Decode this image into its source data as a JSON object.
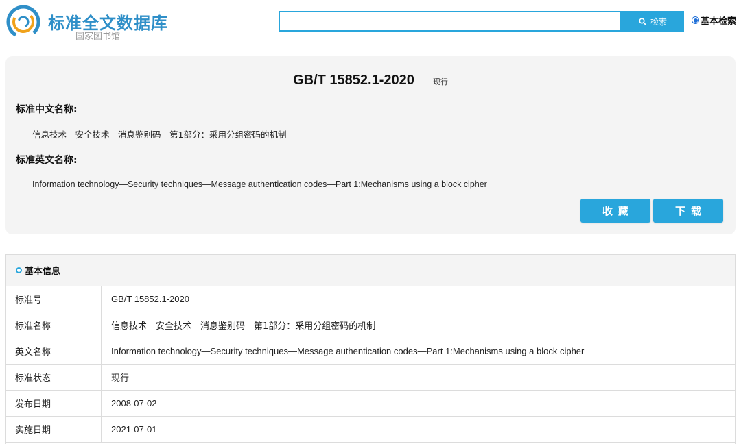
{
  "header": {
    "logo_icon": "circular-swirl-logo-icon",
    "title": "标准全文数据库",
    "subtitle": "国家图书馆",
    "search": {
      "value": "",
      "placeholder": ""
    },
    "search_button_icon": "search-icon",
    "search_button_label": "检索",
    "search_mode_label": "基本检索",
    "search_mode_selected": true
  },
  "summary": {
    "standard_no": "GB/T 15852.1-2020",
    "status": "现行",
    "cn_name_label": "标准中文名称:",
    "cn_name": "信息技术　安全技术　消息鉴别码　第1部分：采用分组密码的机制",
    "en_name_label": "标准英文名称:",
    "en_name": "Information technology—Security techniques—Message authentication codes—Part 1:Mechanisms using a block cipher",
    "collect_label": "收藏",
    "download_label": "下载"
  },
  "basic_info": {
    "title": "基本信息",
    "rows": [
      {
        "key": "标准号",
        "value": "GB/T 15852.1-2020"
      },
      {
        "key": "标准名称",
        "value": "信息技术　安全技术　消息鉴别码　第1部分：采用分组密码的机制"
      },
      {
        "key": "英文名称",
        "value": "Information technology—Security techniques—Message authentication codes—Part 1:Mechanisms using a block cipher"
      },
      {
        "key": "标准状态",
        "value": "现行"
      },
      {
        "key": "发布日期",
        "value": "2008-07-02"
      },
      {
        "key": "实施日期",
        "value": "2021-07-01"
      }
    ]
  },
  "colors": {
    "accent": "#29a6dc",
    "logo_blue": "#2f8fc8",
    "logo_orange": "#f0a21b",
    "panel_bg": "#f4f4f4"
  }
}
